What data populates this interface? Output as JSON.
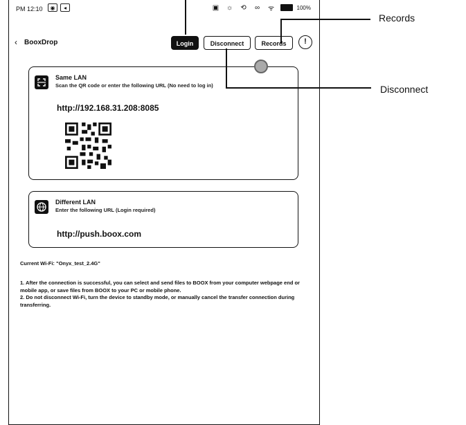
{
  "status_bar": {
    "time": "PM 12:10",
    "battery_pct": "100%"
  },
  "app": {
    "title": "BooxDrop",
    "buttons": {
      "login": "Login",
      "disconnect": "Disconnect",
      "records": "Records",
      "info": "!"
    }
  },
  "same_lan": {
    "title": "Same LAN",
    "subtitle": "Scan the QR code or enter the following URL (No need to log in)",
    "url": "http://192.168.31.208:8085"
  },
  "different_lan": {
    "title": "Different LAN",
    "subtitle": "Enter the following URL (Login required)",
    "url": "http://push.boox.com"
  },
  "wifi": {
    "text": "Current Wi-Fi: \"Onyx_test_2.4G\""
  },
  "notes": [
    "1. After the connection is successful, you can select and send files to BOOX from your computer webpage end or mobile app, or save files from BOOX to your PC or mobile phone.",
    "2. Do not disconnect Wi-Fi, turn the device to standby mode, or manually cancel the transfer connection during transferring."
  ],
  "callouts": {
    "records": "Records",
    "disconnect": "Disconnect"
  }
}
